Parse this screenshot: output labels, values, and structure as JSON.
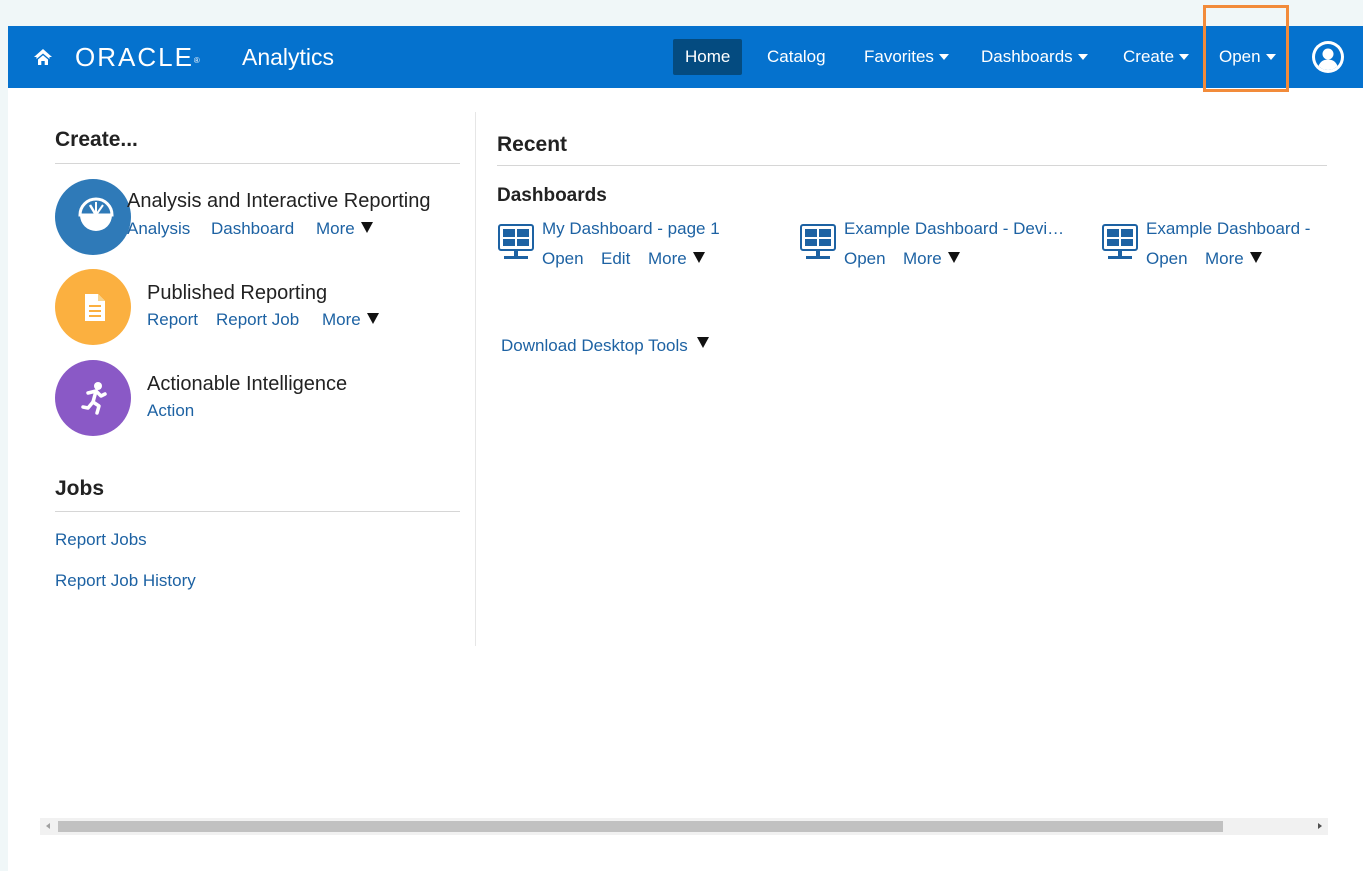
{
  "header": {
    "brand": "ORACLE",
    "brand_mark": "®",
    "product": "Analytics",
    "nav": {
      "home": "Home",
      "catalog": "Catalog",
      "favorites": "Favorites",
      "dashboards": "Dashboards",
      "create": "Create",
      "open": "Open"
    },
    "icons": [
      "home-icon",
      "user-profile-icon",
      "caret-down-icon"
    ],
    "colors": {
      "bar": "#0572ce",
      "active": "#044b80",
      "highlight": "#f28b3a"
    }
  },
  "create_section": {
    "title": "Create...",
    "items": [
      {
        "title": "Analysis and Interactive Reporting",
        "links": [
          "Analysis",
          "Dashboard",
          "More"
        ],
        "icon": "gauge-icon",
        "color": "#2f7ab8"
      },
      {
        "title": "Published Reporting",
        "links": [
          "Report",
          "Report Job",
          "More"
        ],
        "icon": "document-icon",
        "color": "#fbb040"
      },
      {
        "title": "Actionable Intelligence",
        "links": [
          "Action"
        ],
        "icon": "running-person-icon",
        "color": "#8a59c6"
      }
    ]
  },
  "jobs_section": {
    "title": "Jobs",
    "links": [
      "Report Jobs",
      "Report Job History"
    ]
  },
  "recent": {
    "title": "Recent",
    "dashboards_title": "Dashboards",
    "dashboards": [
      {
        "name": "My Dashboard - page 1",
        "actions": [
          "Open",
          "Edit",
          "More"
        ]
      },
      {
        "name": "Example Dashboard - Devi…",
        "actions": [
          "Open",
          "More"
        ]
      },
      {
        "name": "Example Dashboard -",
        "actions": [
          "Open",
          "More"
        ]
      }
    ],
    "download": "Download Desktop Tools"
  }
}
